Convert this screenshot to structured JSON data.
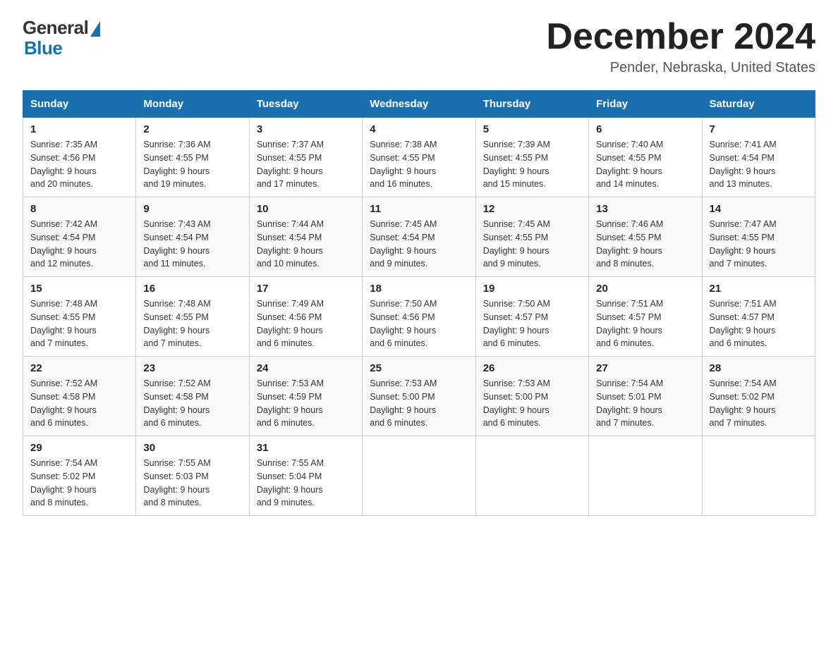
{
  "header": {
    "logo_general": "General",
    "logo_blue": "Blue",
    "month_title": "December 2024",
    "location": "Pender, Nebraska, United States"
  },
  "weekdays": [
    "Sunday",
    "Monday",
    "Tuesday",
    "Wednesday",
    "Thursday",
    "Friday",
    "Saturday"
  ],
  "weeks": [
    [
      {
        "day": "1",
        "sunrise": "7:35 AM",
        "sunset": "4:56 PM",
        "daylight": "9 hours and 20 minutes."
      },
      {
        "day": "2",
        "sunrise": "7:36 AM",
        "sunset": "4:55 PM",
        "daylight": "9 hours and 19 minutes."
      },
      {
        "day": "3",
        "sunrise": "7:37 AM",
        "sunset": "4:55 PM",
        "daylight": "9 hours and 17 minutes."
      },
      {
        "day": "4",
        "sunrise": "7:38 AM",
        "sunset": "4:55 PM",
        "daylight": "9 hours and 16 minutes."
      },
      {
        "day": "5",
        "sunrise": "7:39 AM",
        "sunset": "4:55 PM",
        "daylight": "9 hours and 15 minutes."
      },
      {
        "day": "6",
        "sunrise": "7:40 AM",
        "sunset": "4:55 PM",
        "daylight": "9 hours and 14 minutes."
      },
      {
        "day": "7",
        "sunrise": "7:41 AM",
        "sunset": "4:54 PM",
        "daylight": "9 hours and 13 minutes."
      }
    ],
    [
      {
        "day": "8",
        "sunrise": "7:42 AM",
        "sunset": "4:54 PM",
        "daylight": "9 hours and 12 minutes."
      },
      {
        "day": "9",
        "sunrise": "7:43 AM",
        "sunset": "4:54 PM",
        "daylight": "9 hours and 11 minutes."
      },
      {
        "day": "10",
        "sunrise": "7:44 AM",
        "sunset": "4:54 PM",
        "daylight": "9 hours and 10 minutes."
      },
      {
        "day": "11",
        "sunrise": "7:45 AM",
        "sunset": "4:54 PM",
        "daylight": "9 hours and 9 minutes."
      },
      {
        "day": "12",
        "sunrise": "7:45 AM",
        "sunset": "4:55 PM",
        "daylight": "9 hours and 9 minutes."
      },
      {
        "day": "13",
        "sunrise": "7:46 AM",
        "sunset": "4:55 PM",
        "daylight": "9 hours and 8 minutes."
      },
      {
        "day": "14",
        "sunrise": "7:47 AM",
        "sunset": "4:55 PM",
        "daylight": "9 hours and 7 minutes."
      }
    ],
    [
      {
        "day": "15",
        "sunrise": "7:48 AM",
        "sunset": "4:55 PM",
        "daylight": "9 hours and 7 minutes."
      },
      {
        "day": "16",
        "sunrise": "7:48 AM",
        "sunset": "4:55 PM",
        "daylight": "9 hours and 7 minutes."
      },
      {
        "day": "17",
        "sunrise": "7:49 AM",
        "sunset": "4:56 PM",
        "daylight": "9 hours and 6 minutes."
      },
      {
        "day": "18",
        "sunrise": "7:50 AM",
        "sunset": "4:56 PM",
        "daylight": "9 hours and 6 minutes."
      },
      {
        "day": "19",
        "sunrise": "7:50 AM",
        "sunset": "4:57 PM",
        "daylight": "9 hours and 6 minutes."
      },
      {
        "day": "20",
        "sunrise": "7:51 AM",
        "sunset": "4:57 PM",
        "daylight": "9 hours and 6 minutes."
      },
      {
        "day": "21",
        "sunrise": "7:51 AM",
        "sunset": "4:57 PM",
        "daylight": "9 hours and 6 minutes."
      }
    ],
    [
      {
        "day": "22",
        "sunrise": "7:52 AM",
        "sunset": "4:58 PM",
        "daylight": "9 hours and 6 minutes."
      },
      {
        "day": "23",
        "sunrise": "7:52 AM",
        "sunset": "4:58 PM",
        "daylight": "9 hours and 6 minutes."
      },
      {
        "day": "24",
        "sunrise": "7:53 AM",
        "sunset": "4:59 PM",
        "daylight": "9 hours and 6 minutes."
      },
      {
        "day": "25",
        "sunrise": "7:53 AM",
        "sunset": "5:00 PM",
        "daylight": "9 hours and 6 minutes."
      },
      {
        "day": "26",
        "sunrise": "7:53 AM",
        "sunset": "5:00 PM",
        "daylight": "9 hours and 6 minutes."
      },
      {
        "day": "27",
        "sunrise": "7:54 AM",
        "sunset": "5:01 PM",
        "daylight": "9 hours and 7 minutes."
      },
      {
        "day": "28",
        "sunrise": "7:54 AM",
        "sunset": "5:02 PM",
        "daylight": "9 hours and 7 minutes."
      }
    ],
    [
      {
        "day": "29",
        "sunrise": "7:54 AM",
        "sunset": "5:02 PM",
        "daylight": "9 hours and 8 minutes."
      },
      {
        "day": "30",
        "sunrise": "7:55 AM",
        "sunset": "5:03 PM",
        "daylight": "9 hours and 8 minutes."
      },
      {
        "day": "31",
        "sunrise": "7:55 AM",
        "sunset": "5:04 PM",
        "daylight": "9 hours and 9 minutes."
      },
      null,
      null,
      null,
      null
    ]
  ],
  "labels": {
    "sunrise": "Sunrise:",
    "sunset": "Sunset:",
    "daylight": "Daylight:"
  }
}
